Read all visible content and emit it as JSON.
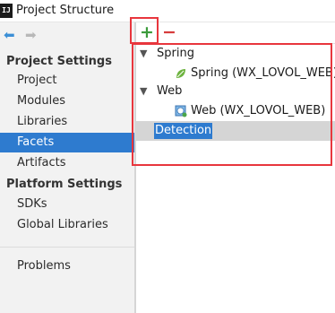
{
  "window": {
    "app_icon": "IJ",
    "title": "Project Structure"
  },
  "nav": {
    "back_icon": "arrow-left-icon",
    "forward_icon": "arrow-right-icon"
  },
  "sidebar": {
    "project_settings_header": "Project Settings",
    "project_items": [
      "Project",
      "Modules",
      "Libraries",
      "Facets",
      "Artifacts"
    ],
    "selected_item": "Facets",
    "platform_settings_header": "Platform Settings",
    "platform_items": [
      "SDKs",
      "Global Libraries"
    ],
    "other_items": [
      "Problems"
    ]
  },
  "toolbar": {
    "add_label": "+",
    "remove_label": "−"
  },
  "tree": {
    "spring_group": "Spring",
    "spring_facet": "Spring (WX_LOVOL_WEB)",
    "web_group": "Web",
    "web_facet": "Web (WX_LOVOL_WEB)",
    "detection": "Detection"
  },
  "colors": {
    "selection": "#2e7bcf",
    "highlight_box": "#e8363d",
    "add": "#3c9b3c",
    "remove": "#d63b3b",
    "spring_leaf": "#6db33f"
  }
}
